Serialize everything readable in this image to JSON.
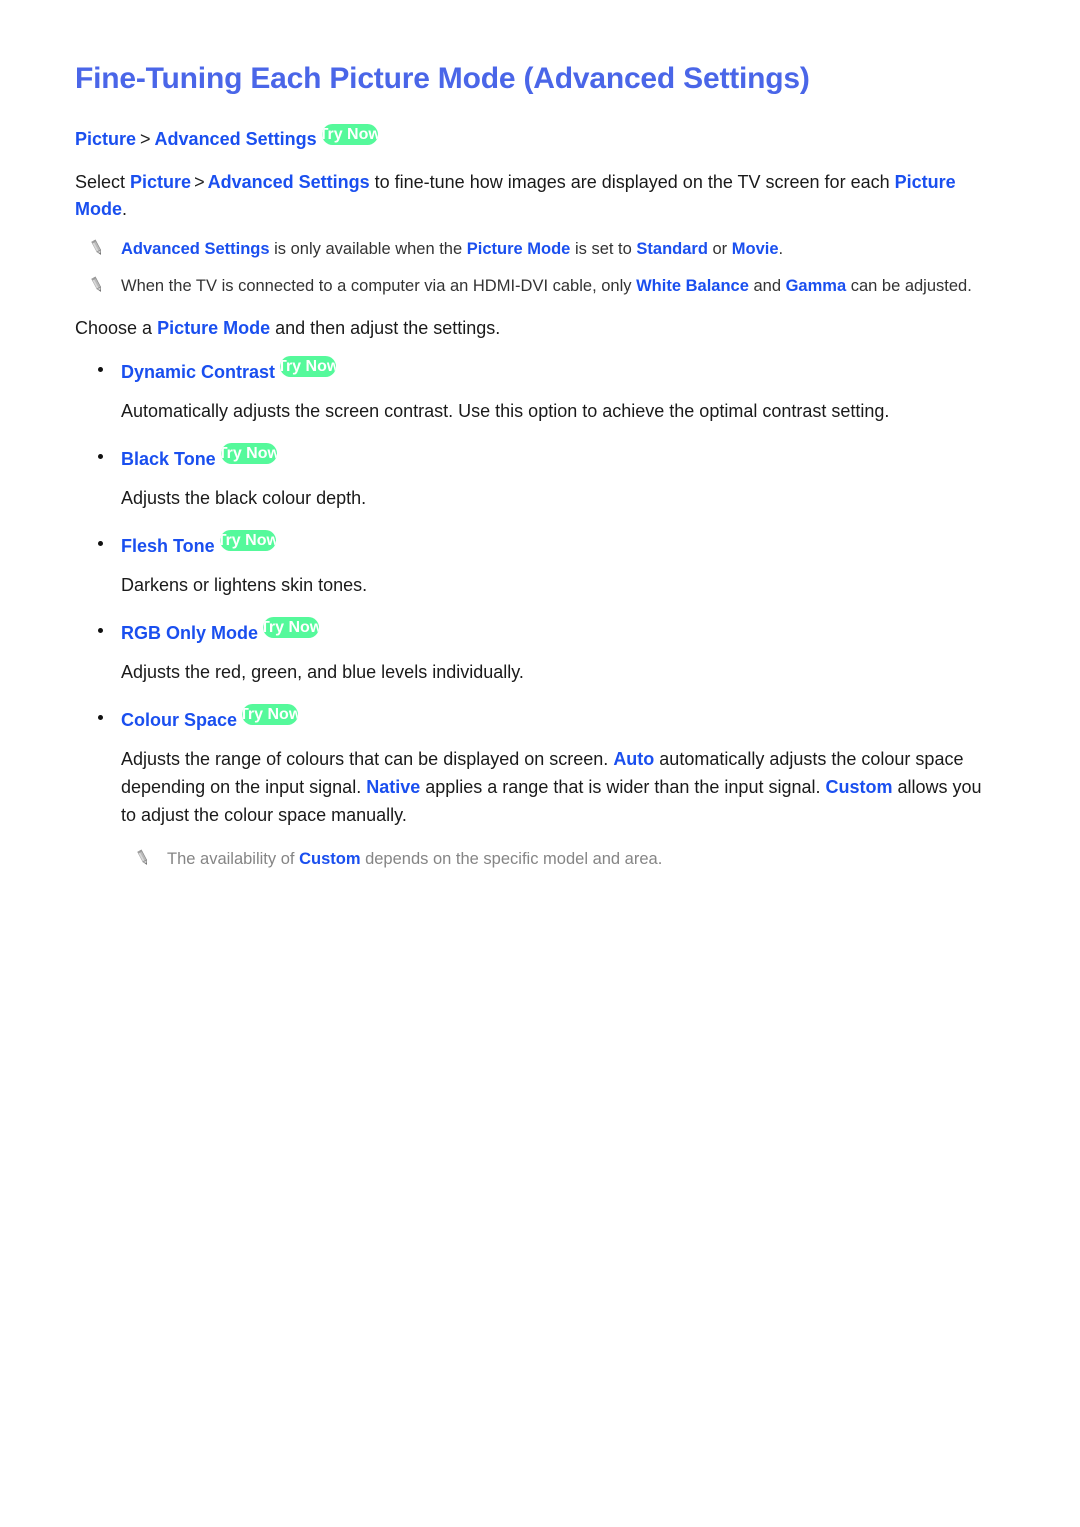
{
  "page": {
    "title": "Fine-Tuning Each Picture Mode (Advanced Settings)",
    "try_now_label": "Try Now",
    "breadcrumb_separator": ">",
    "accent_heading_color": "#4A66E8",
    "accent_term_color": "#1A4FEF",
    "badge_color": "#55F99B",
    "badge_text_color": "#FFFFFF",
    "note_text_color": "#333333",
    "note_dim_text_color": "#858585"
  },
  "breadcrumb": {
    "items": [
      "Picture",
      "Advanced Settings"
    ]
  },
  "intro": {
    "lead": "Select ",
    "term_1": "Picture",
    "term_2": "Advanced Settings",
    "tail": " to fine-tune how images are displayed on the TV screen for each ",
    "term_3": "Picture Mode",
    "end": "."
  },
  "notes_top": [
    {
      "icon": "pencil-icon",
      "term_1": "Advanced Settings",
      "text_1": " is only available when the ",
      "term_2": "Picture Mode",
      "text_2": " is set to ",
      "term_3": "Standard",
      "text_3": " or ",
      "term_4": "Movie",
      "text_4": "."
    },
    {
      "icon": "pencil-icon",
      "text_1": "When the TV is connected to a computer via an HDMI-DVI cable, only ",
      "term_1": "White Balance",
      "text_2": " and ",
      "term_2": "Gamma",
      "text_3": " can be adjusted."
    }
  ],
  "choose": {
    "lead": "Choose a ",
    "term": "Picture Mode",
    "tail": " and then adjust the settings."
  },
  "features": [
    {
      "name": "Dynamic Contrast",
      "has_try_now": true,
      "description": "Automatically adjusts the screen contrast. Use this option to achieve the optimal contrast setting."
    },
    {
      "name": "Black Tone",
      "has_try_now": true,
      "description": "Adjusts the black colour depth."
    },
    {
      "name": "Flesh Tone",
      "has_try_now": true,
      "description": "Darkens or lightens skin tones."
    },
    {
      "name": "RGB Only Mode",
      "has_try_now": true,
      "description": "Adjusts the red, green, and blue levels individually."
    },
    {
      "name": "Colour Space",
      "has_try_now": true,
      "description_parts": {
        "text_1": "Adjusts the range of colours that can be displayed on screen. ",
        "term_1": "Auto",
        "text_2": " automatically adjusts the colour space depending on the input signal. ",
        "term_2": "Native",
        "text_3": " applies a range that is wider than the input signal. ",
        "term_3": "Custom",
        "text_4": " allows you to adjust the colour space manually."
      },
      "note": {
        "icon": "pencil-icon",
        "text_1": "The availability of ",
        "term_1": "Custom",
        "text_2": " depends on the specific model and area."
      }
    }
  ]
}
